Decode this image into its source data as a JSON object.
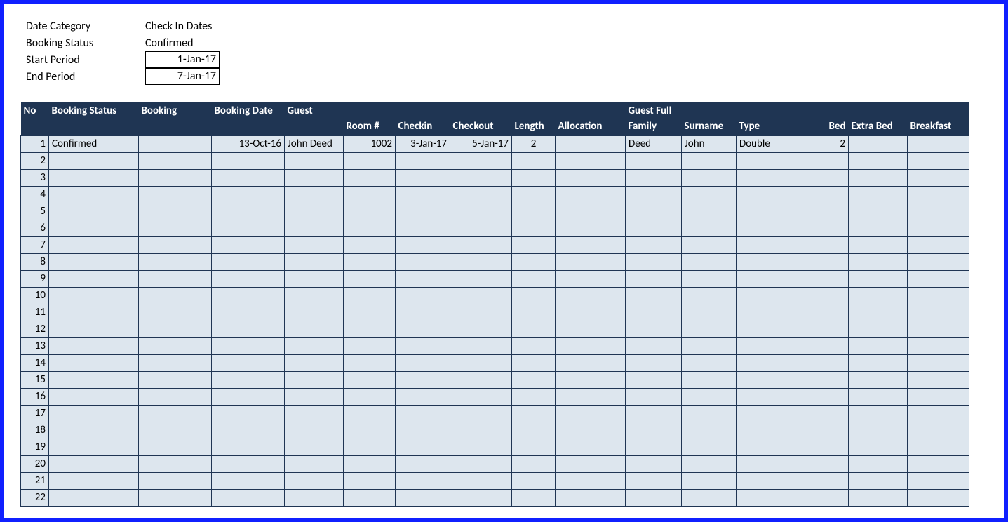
{
  "filters": {
    "date_category": {
      "label": "Date Category",
      "value": "Check In Dates"
    },
    "booking_status": {
      "label": "Booking Status",
      "value": "Confirmed"
    },
    "start_period": {
      "label": "Start Period",
      "value": "1-Jan-17"
    },
    "end_period": {
      "label": "End Period",
      "value": "7-Jan-17"
    }
  },
  "headers": {
    "no": "No",
    "booking_status": "Booking Status",
    "booking": "Booking",
    "booking_date": "Booking Date",
    "guest": "Guest",
    "room": "Room #",
    "checkin": "Checkin",
    "checkout": "Checkout",
    "length": "Length",
    "allocation": "Allocation",
    "guest_full": "Guest Full",
    "family": "Family",
    "surname": "Surname",
    "type": "Type",
    "bed": "Bed",
    "extra_bed": "Extra Bed",
    "breakfast": "Breakfast"
  },
  "rows": [
    {
      "no": "1",
      "status": "Confirmed",
      "booking": "",
      "booking_date": "13-Oct-16",
      "guest": "John Deed",
      "room": "1002",
      "checkin": "3-Jan-17",
      "checkout": "5-Jan-17",
      "length": "2",
      "allocation": "",
      "family": "Deed",
      "surname": "John",
      "type": "Double",
      "bed": "2",
      "extra_bed": "",
      "breakfast": ""
    },
    {
      "no": "2"
    },
    {
      "no": "3"
    },
    {
      "no": "4"
    },
    {
      "no": "5"
    },
    {
      "no": "6"
    },
    {
      "no": "7"
    },
    {
      "no": "8"
    },
    {
      "no": "9"
    },
    {
      "no": "10"
    },
    {
      "no": "11"
    },
    {
      "no": "12"
    },
    {
      "no": "13"
    },
    {
      "no": "14"
    },
    {
      "no": "15"
    },
    {
      "no": "16"
    },
    {
      "no": "17"
    },
    {
      "no": "18"
    },
    {
      "no": "19"
    },
    {
      "no": "20"
    },
    {
      "no": "21"
    },
    {
      "no": "22"
    }
  ]
}
